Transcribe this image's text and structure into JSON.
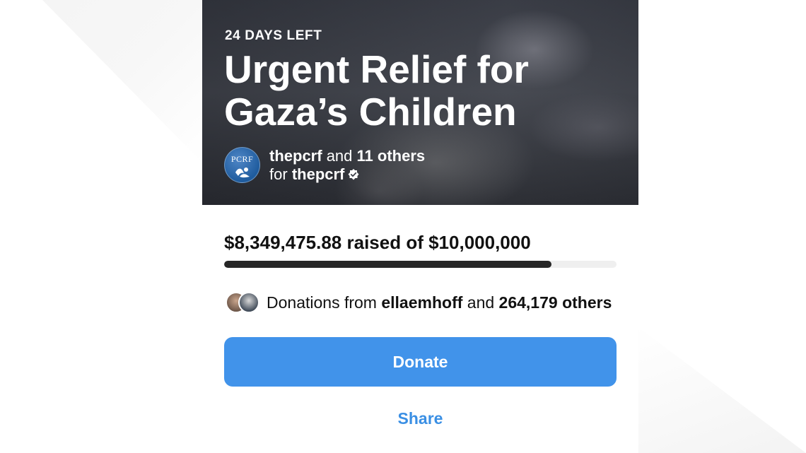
{
  "fundraiser": {
    "days_left": "24 DAYS LEFT",
    "title": "Urgent Relief for Gaza’s Children",
    "organizer": {
      "avatar_text": "PCRF",
      "name": "thepcrf",
      "and_text": "and",
      "others": "11 others",
      "for_text": "for",
      "beneficiary": "thepcrf",
      "verified_icon": "verified-badge-icon"
    }
  },
  "progress": {
    "raised_text": "$8,349,475.88 raised of $10,000,000",
    "raised_amount": 8349475.88,
    "goal_amount": 10000000,
    "fraction": 0.835
  },
  "donations": {
    "from_text": "Donations from",
    "donor": "ellaemhoff",
    "and_text": "and",
    "others": "264,179 others"
  },
  "actions": {
    "donate_label": "Donate",
    "share_label": "Share"
  },
  "colors": {
    "accent": "#4193ea",
    "link": "#3a8fe4",
    "progress_fill": "#262626",
    "progress_track": "#efefef"
  }
}
